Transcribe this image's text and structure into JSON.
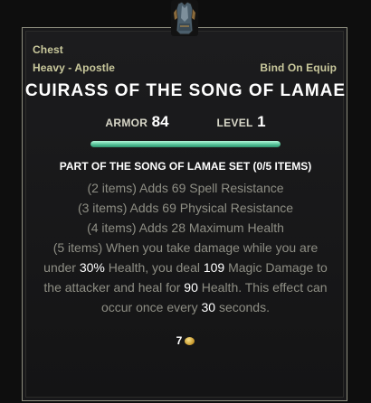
{
  "item": {
    "slot": "Chest",
    "weight_style": "Heavy - Apostle",
    "bind": "Bind On Equip",
    "name": "CUIRASS OF THE SONG OF LAMAE"
  },
  "stats": {
    "armor_label": "ARMOR",
    "armor_value": "84",
    "level_label": "LEVEL",
    "level_value": "1"
  },
  "condition_bar": {
    "fill_fraction": 1.0,
    "color": "#4fbf94"
  },
  "set": {
    "title": "PART OF THE SONG OF LAMAE SET (0/5 ITEMS)",
    "bonus_1": "(2 items) Adds 69 Spell Resistance",
    "bonus_2": "(3 items) Adds 69 Physical Resistance",
    "bonus_3": "(4 items) Adds 28 Maximum Health",
    "bonus_5_a": "(5 items) When you take damage while you are",
    "bonus_5_b_pre": "under ",
    "bonus_5_b_hl1": "30%",
    "bonus_5_b_mid": " Health, you deal ",
    "bonus_5_b_hl2": "109",
    "bonus_5_b_post": " Magic Damage to",
    "bonus_5_c_pre": "the attacker and heal for ",
    "bonus_5_c_hl": "90",
    "bonus_5_c_post": " Health. This effect can",
    "bonus_5_d_pre": "occur once every ",
    "bonus_5_d_hl": "30",
    "bonus_5_d_post": " seconds."
  },
  "value": {
    "amount": "7",
    "currency_icon": "gold-coin-icon"
  },
  "icon": {
    "name": "cuirass-icon"
  }
}
